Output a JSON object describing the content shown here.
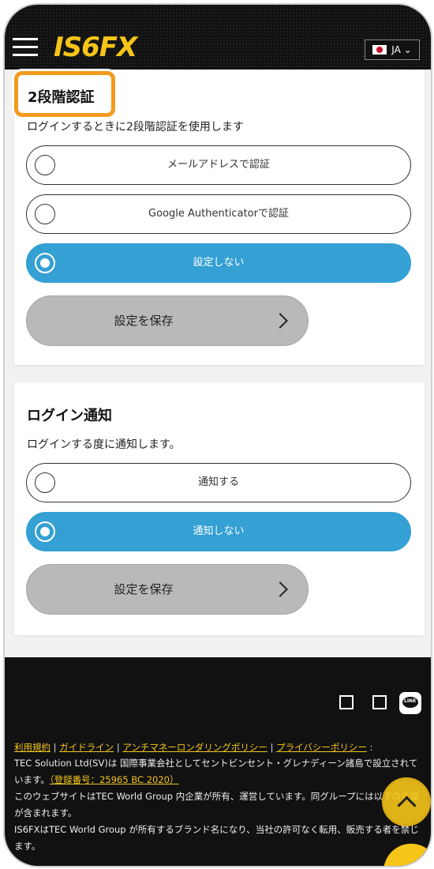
{
  "header": {
    "logo": "IS6FX",
    "lang": "JA ⌄"
  },
  "callout_title": "2段階認証",
  "twofa": {
    "description": "ログインするときに2段階認証を使用します",
    "options": [
      "メールアドレスで認証",
      "Google Authenticatorで認証",
      "設定しない"
    ],
    "selected_index": 2,
    "save_label": "設定を保存"
  },
  "login_notify": {
    "title": "ログイン通知",
    "description": "ログインする度に通知します。",
    "options": [
      "通知する",
      "通知しない"
    ],
    "selected_index": 1,
    "save_label": "設定を保存"
  },
  "footer": {
    "links": [
      "利用規約",
      "ガイドライン",
      "アンチマネーロンダリングポリシー",
      "プライバシーポリシー"
    ],
    "line_icon": "LINE",
    "text1": "TEC Solution Ltd(SV)は 国際事業会社としてセントビンセント・グレナディーン諸島で設立されています。",
    "reg_number": "（登録番号：25965 BC 2020）",
    "text2": "このウェブサイトはTEC World Group 内企業が所有、運営しています。同グループには以下の企業が含まれます。",
    "text3": "IS6FXはTEC World Group が所有するブランド名になり、当社の許可なく転用、販売する者を禁じます。"
  },
  "colors": {
    "accent": "#35a0d3",
    "brand": "#f5c518",
    "callout": "#f39a1e"
  }
}
